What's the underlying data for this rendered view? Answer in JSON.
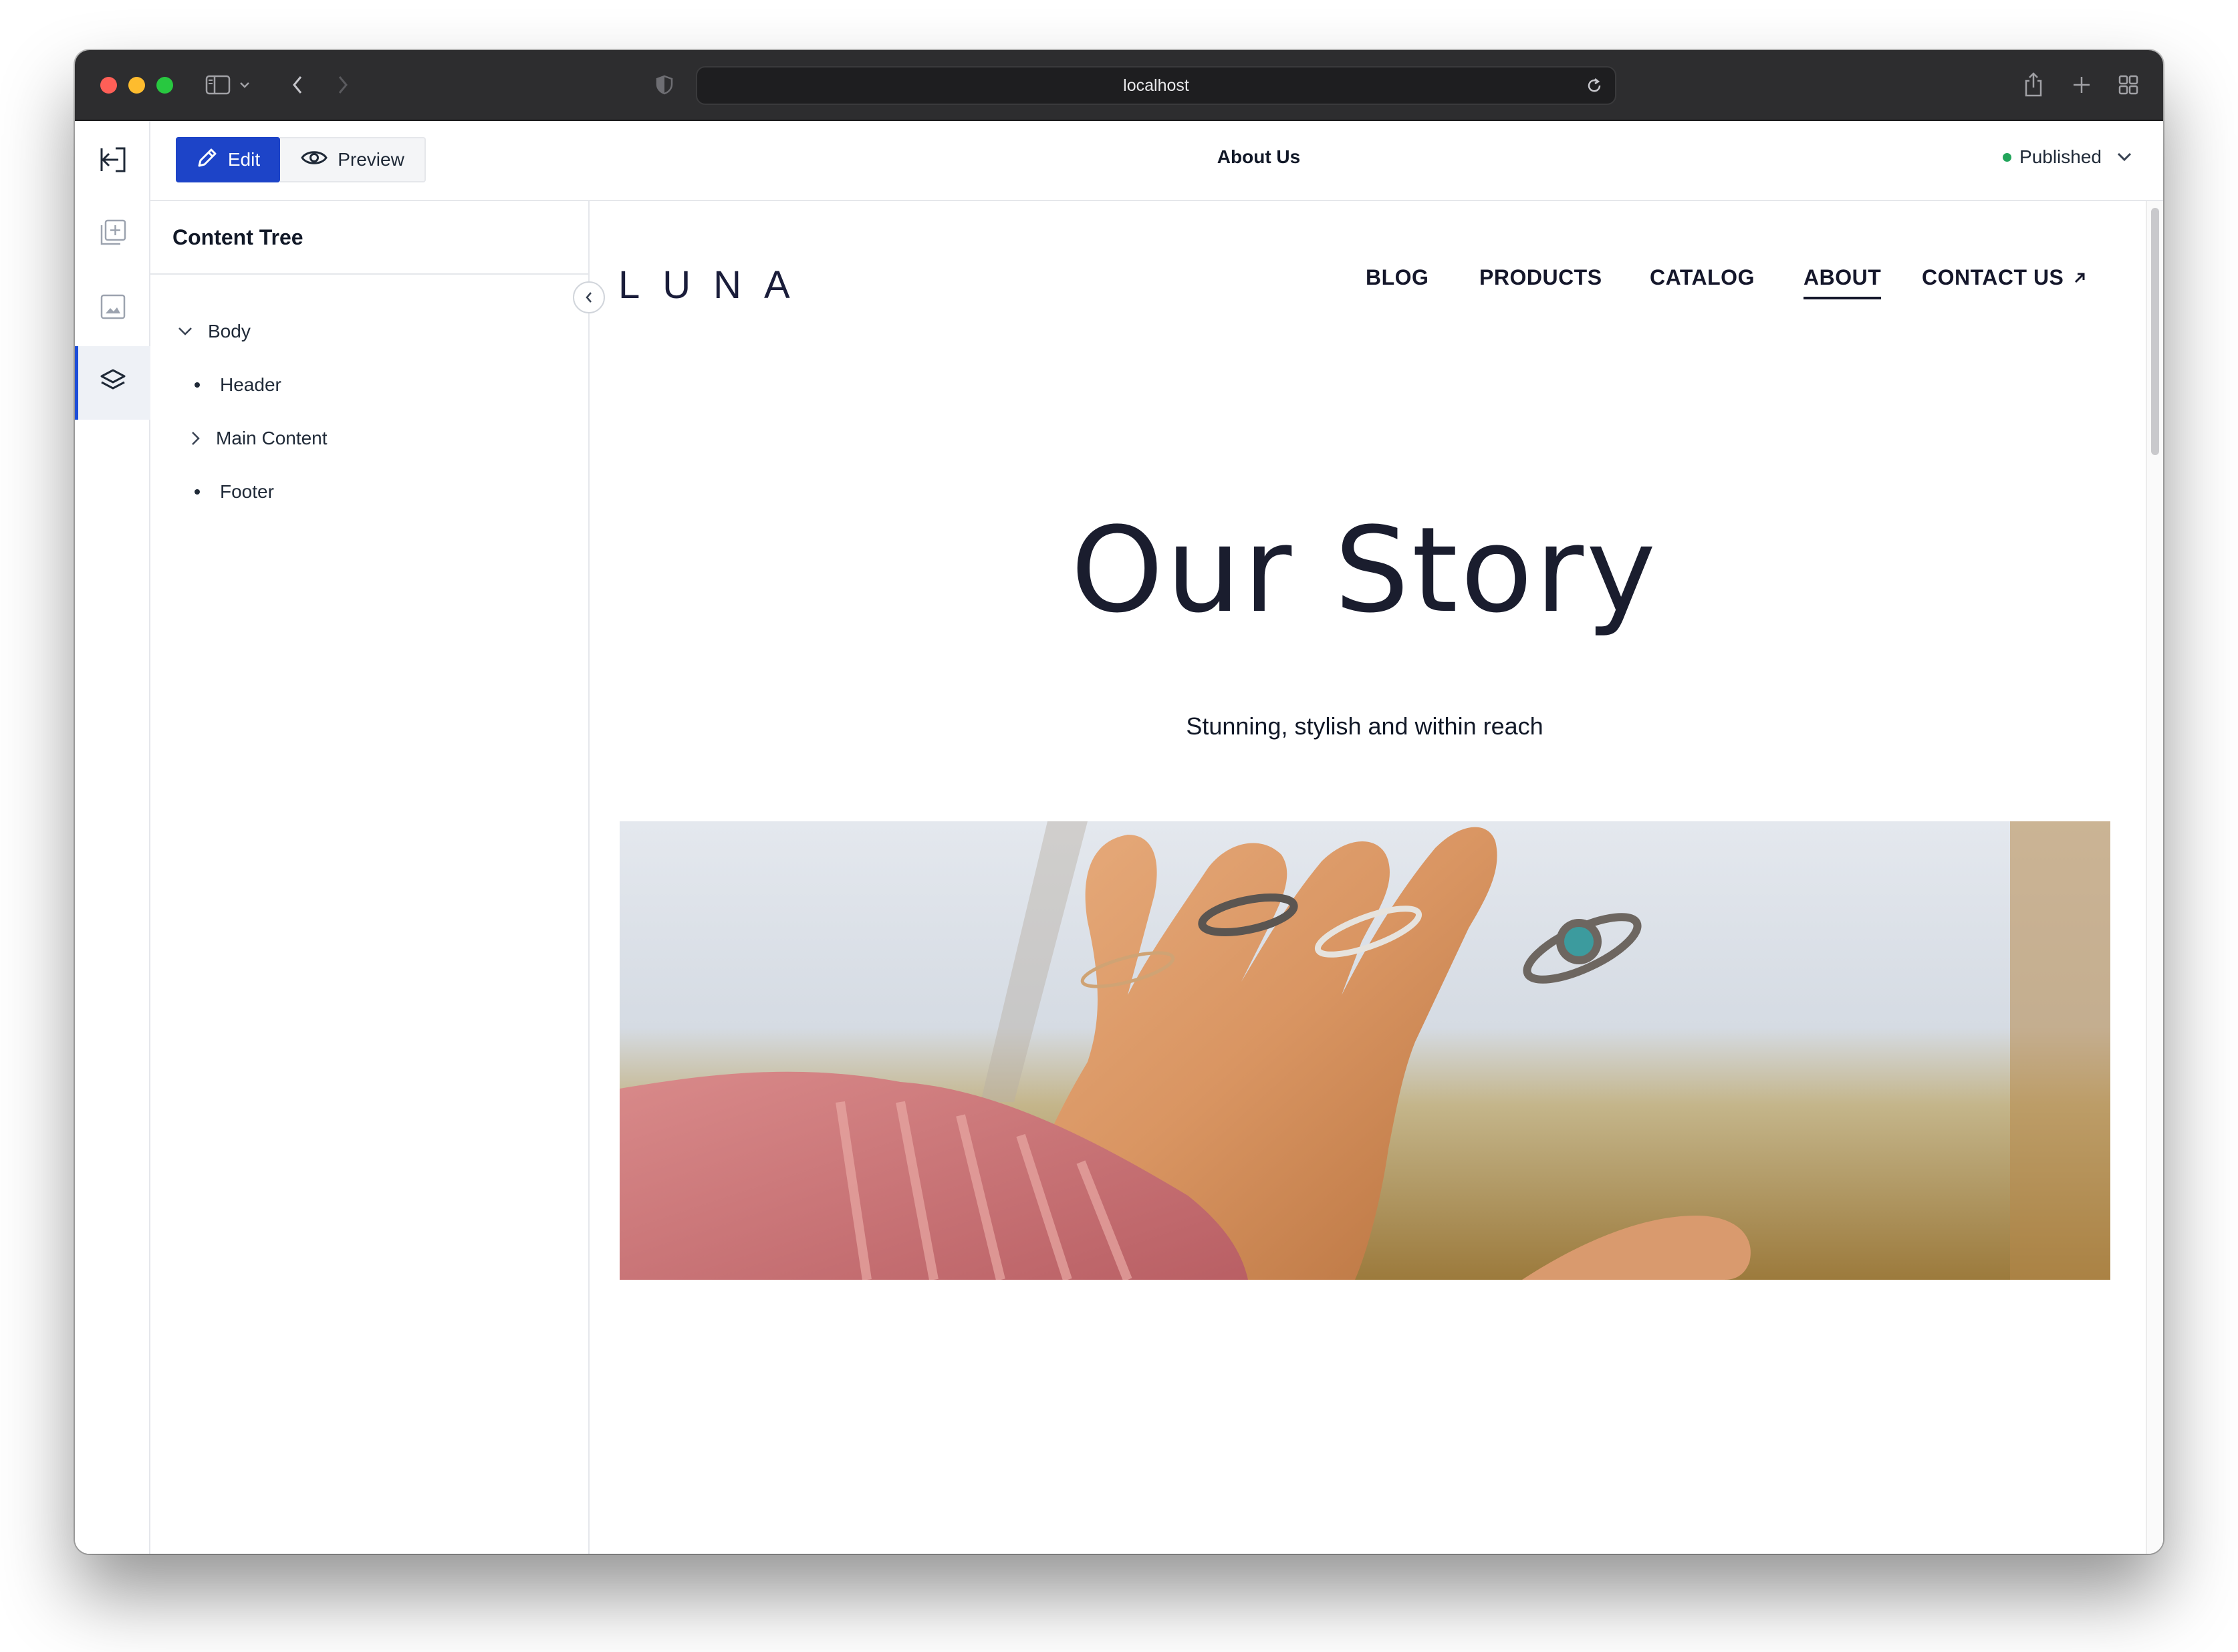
{
  "browser": {
    "url": "localhost"
  },
  "app": {
    "edit_label": "Edit",
    "preview_label": "Preview",
    "page_name": "About Us",
    "status_label": "Published",
    "status_color": "#22a55b",
    "accent_color": "#1d44c8",
    "rail_icons": [
      "exit-icon",
      "add-block-icon",
      "image-icon",
      "layers-icon"
    ]
  },
  "tree": {
    "title": "Content Tree",
    "items": [
      {
        "label": "Body",
        "kind": "expanded"
      },
      {
        "label": "Header",
        "kind": "leaf"
      },
      {
        "label": "Main Content",
        "kind": "collapsed"
      },
      {
        "label": "Footer",
        "kind": "leaf"
      }
    ]
  },
  "site": {
    "logo": "LUNA",
    "nav": [
      "BLOG",
      "PRODUCTS",
      "CATALOG",
      "ABOUT"
    ],
    "active_nav": "ABOUT",
    "contact": "CONTACT US",
    "hero_title": "Our Story",
    "hero_subtitle": "Stunning, stylish and within reach"
  }
}
